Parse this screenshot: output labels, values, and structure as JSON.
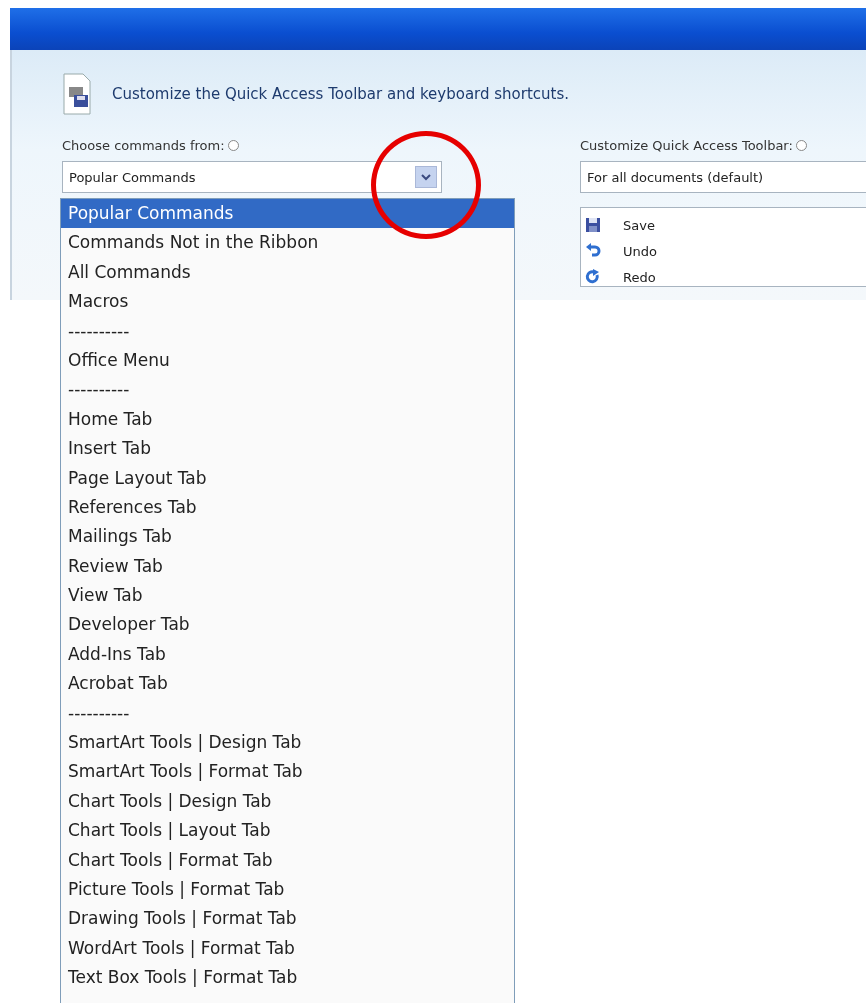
{
  "header": {
    "text": "Customize the Quick Access Toolbar and keyboard shortcuts."
  },
  "choose_commands": {
    "label": "Choose commands from:",
    "value": "Popular Commands",
    "options": [
      {
        "label": "Popular Commands",
        "selected": true
      },
      {
        "label": "Commands Not in the Ribbon",
        "selected": false
      },
      {
        "label": "All Commands",
        "selected": false
      },
      {
        "label": "Macros",
        "selected": false
      },
      {
        "label": "----------",
        "selected": false
      },
      {
        "label": "Office Menu",
        "selected": false
      },
      {
        "label": "----------",
        "selected": false
      },
      {
        "label": "Home Tab",
        "selected": false
      },
      {
        "label": "Insert Tab",
        "selected": false
      },
      {
        "label": "Page Layout Tab",
        "selected": false
      },
      {
        "label": "References Tab",
        "selected": false
      },
      {
        "label": "Mailings Tab",
        "selected": false
      },
      {
        "label": "Review Tab",
        "selected": false
      },
      {
        "label": "View Tab",
        "selected": false
      },
      {
        "label": "Developer Tab",
        "selected": false
      },
      {
        "label": "Add-Ins Tab",
        "selected": false
      },
      {
        "label": "Acrobat Tab",
        "selected": false
      },
      {
        "label": "----------",
        "selected": false
      },
      {
        "label": "SmartArt Tools | Design Tab",
        "selected": false
      },
      {
        "label": "SmartArt Tools | Format Tab",
        "selected": false
      },
      {
        "label": "Chart Tools | Design Tab",
        "selected": false
      },
      {
        "label": "Chart Tools | Layout Tab",
        "selected": false
      },
      {
        "label": "Chart Tools | Format Tab",
        "selected": false
      },
      {
        "label": "Picture Tools | Format Tab",
        "selected": false
      },
      {
        "label": "Drawing Tools | Format Tab",
        "selected": false
      },
      {
        "label": "WordArt Tools | Format Tab",
        "selected": false
      },
      {
        "label": "Text Box Tools | Format Tab",
        "selected": false
      }
    ]
  },
  "customize_toolbar": {
    "label": "Customize Quick Access Toolbar:",
    "value": "For all documents (default)",
    "commands": [
      {
        "label": "Save",
        "kind": "save"
      },
      {
        "label": "Undo",
        "kind": "undo"
      },
      {
        "label": "Redo",
        "kind": "redo"
      }
    ]
  }
}
